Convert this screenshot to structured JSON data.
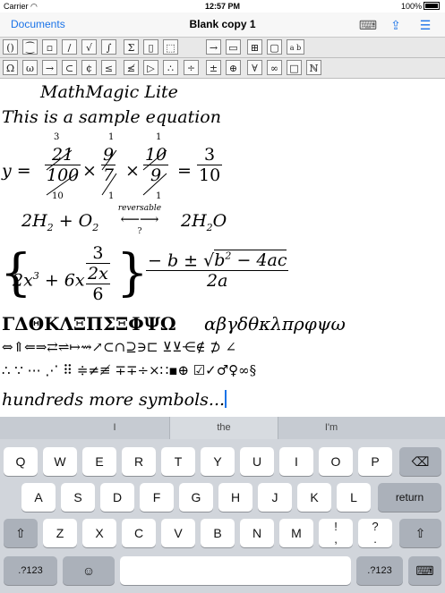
{
  "status": {
    "carrier": "Carrier",
    "time": "12:57 PM",
    "battery": "100%"
  },
  "navbar": {
    "back_label": "Documents",
    "title": "Blank copy 1"
  },
  "toolbar1": [
    "()",
    "⁐",
    "▫",
    "∕",
    "√",
    "∫",
    "Σ",
    "▯",
    "⬚",
    "→",
    "▭",
    "⊞",
    "▢",
    "a b"
  ],
  "toolbar2": [
    "Ω",
    "ω",
    "→",
    "⊂",
    "¢",
    "≤",
    "≰",
    "▷",
    "∴",
    "÷",
    "±",
    "⊕",
    "∀",
    "∞",
    "□",
    "ℕ"
  ],
  "editor": {
    "line1": "MathMagic Lite",
    "line2": "This is a sample equation",
    "eq1": {
      "lhs": "y =",
      "f1_top_cancel": "3",
      "f1_num": "21",
      "f1_den": "100",
      "f1_bot_cancel": "10",
      "f2_top_cancel": "1",
      "f2_num": "9",
      "f2_den": "7",
      "f2_bot_cancel": "1",
      "f3_top_cancel": "1",
      "f3_num": "10",
      "f3_den": "9",
      "f3_bot_cancel": "1",
      "times": "×",
      "eq": "=",
      "r_num": "3",
      "r_den": "10"
    },
    "eq2": {
      "left": "2H",
      "sub1": "2",
      "plus": " + O",
      "sub2": "2",
      "over": "reversable",
      "under": "?",
      "right": "2H",
      "sub3": "2",
      "right2": "O"
    },
    "eq3": {
      "brace_l": "{",
      "term": "2x",
      "exp": "3",
      "plus": " + 6x",
      "n_top": "3",
      "n_mid": "2x",
      "n_bot": "6",
      "brace_r": "}"
    },
    "eq4": {
      "minus_b": "− b ± ",
      "sqrt_in": "b",
      "exp": "2",
      "rest": " − 4ac",
      "den": "2a"
    },
    "greek_upper": "ΓΔΘΚΛΞΠΣΞΦΨΩ",
    "greek_lower": "αβγδθκλπρφψω",
    "arrows_row": "⇔⇑⇐⇒⇄⇌↦⇝↗⊂∩⊇∋⊏ ⊻⊻⋲∉ ⊅ ∠",
    "dots_row": "∴ ∵ ⋯ ⋰ ⠿ ≑≠≢ ∓∓÷×∷▪⊕ ☑✓♂♀∞§",
    "last_line": "hundreds more symbols..."
  },
  "keyboard": {
    "suggestions": [
      "I",
      "the",
      "I'm"
    ],
    "row1": [
      "Q",
      "W",
      "E",
      "R",
      "T",
      "Y",
      "U",
      "I",
      "O",
      "P"
    ],
    "row2": [
      "A",
      "S",
      "D",
      "F",
      "G",
      "H",
      "J",
      "K",
      "L"
    ],
    "row3": [
      "Z",
      "X",
      "C",
      "V",
      "B",
      "N",
      "M",
      "!\n,",
      "?\n."
    ],
    "return_label": "return",
    "num_label": ".?123"
  }
}
